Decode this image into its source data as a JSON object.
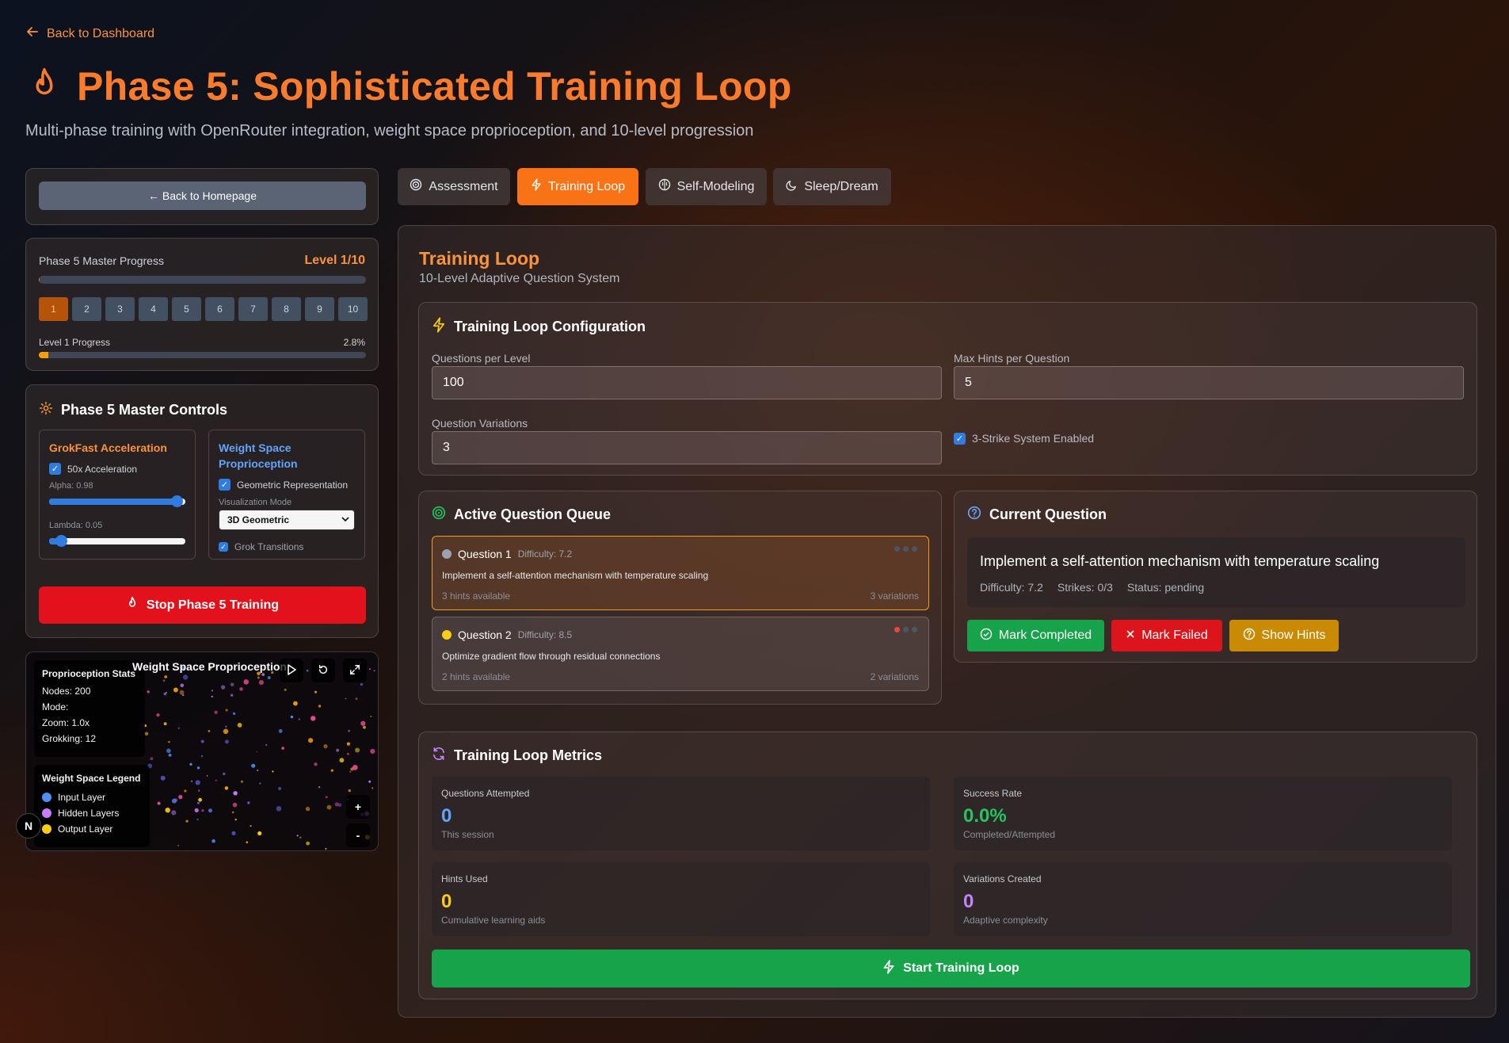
{
  "header": {
    "back_label": "Back to Dashboard",
    "title": "Phase 5: Sophisticated Training Loop",
    "subtitle": "Multi-phase training with OpenRouter integration, weight space proprioception, and 10-level progression"
  },
  "sidebar": {
    "back_homepage": "← Back to Homepage",
    "master_progress": {
      "label": "Phase 5 Master Progress",
      "level_text": "Level 1/10",
      "overall_progress": 0.3,
      "levels": [
        "1",
        "2",
        "3",
        "4",
        "5",
        "6",
        "7",
        "8",
        "9",
        "10"
      ],
      "active_level": "1",
      "level_progress_label": "Level 1 Progress",
      "level_progress_value": "2.8%",
      "level_progress_fraction": 2.8
    },
    "controls": {
      "title": "Phase 5 Master Controls",
      "grokfast": {
        "title": "GrokFast Acceleration",
        "acceleration_label": "50x Acceleration",
        "alpha_label": "Alpha: 0.98",
        "alpha_value": 0.98,
        "lambda_label": "Lambda: 0.05",
        "lambda_value": 0.05
      },
      "weight_space": {
        "title": "Weight Space Proprioception",
        "geometric_label": "Geometric Representation",
        "viz_mode_label": "Visualization Mode",
        "viz_mode_value": "3D Geometric",
        "grok_transitions_label": "Grok Transitions"
      },
      "stop_button": "Stop Phase 5 Training"
    },
    "visualization": {
      "stats_title": "Proprioception Stats",
      "nodes": "Nodes: 200",
      "mode": "Mode:",
      "zoom": "Zoom: 1.0x",
      "grokking": "Grokking: 12",
      "title": "Weight Space Proprioception",
      "legend_title": "Weight Space Legend",
      "legend": [
        {
          "label": "Input Layer",
          "color": "#4f8ff7"
        },
        {
          "label": "Hidden Layers",
          "color": "#c77dff"
        },
        {
          "label": "Output Layer",
          "color": "#facc15"
        }
      ],
      "zoom_in": "+",
      "zoom_out": "-",
      "badge": "N"
    }
  },
  "tabs": [
    {
      "label": "Assessment"
    },
    {
      "label": "Training Loop"
    },
    {
      "label": "Self-Modeling"
    },
    {
      "label": "Sleep/Dream"
    }
  ],
  "main": {
    "title": "Training Loop",
    "subtitle": "10-Level Adaptive Question System",
    "config": {
      "title": "Training Loop Configuration",
      "questions_per_level_label": "Questions per Level",
      "questions_per_level": "100",
      "max_hints_label": "Max Hints per Question",
      "max_hints": "5",
      "variations_label": "Question Variations",
      "variations": "3",
      "strike_label": "3-Strike System Enabled"
    },
    "queue": {
      "title": "Active Question Queue",
      "items": [
        {
          "name": "Question 1",
          "difficulty": "Difficulty: 7.2",
          "text": "Implement a self-attention mechanism with temperature scaling",
          "hints": "3 hints available",
          "variations": "3 variations"
        },
        {
          "name": "Question 2",
          "difficulty": "Difficulty: 8.5",
          "text": "Optimize gradient flow through residual connections",
          "hints": "2 hints available",
          "variations": "2 variations"
        }
      ]
    },
    "current": {
      "title": "Current Question",
      "text": "Implement a self-attention mechanism with temperature scaling",
      "difficulty": "Difficulty: 7.2",
      "strikes": "Strikes: 0/3",
      "status": "Status: pending",
      "mark_completed": "Mark Completed",
      "mark_failed": "Mark Failed",
      "show_hints": "Show Hints"
    },
    "metrics": {
      "title": "Training Loop Metrics",
      "items": [
        {
          "label": "Questions Attempted",
          "value": "0",
          "note": "This session",
          "color": "#60a5fa"
        },
        {
          "label": "Success Rate",
          "value": "0.0%",
          "note": "Completed/Attempted",
          "color": "#22c55e"
        },
        {
          "label": "Hints Used",
          "value": "0",
          "note": "Cumulative learning aids",
          "color": "#facc15"
        },
        {
          "label": "Variations Created",
          "value": "0",
          "note": "Adaptive complexity",
          "color": "#c084fc"
        }
      ],
      "start_button": "Start Training Loop"
    }
  }
}
